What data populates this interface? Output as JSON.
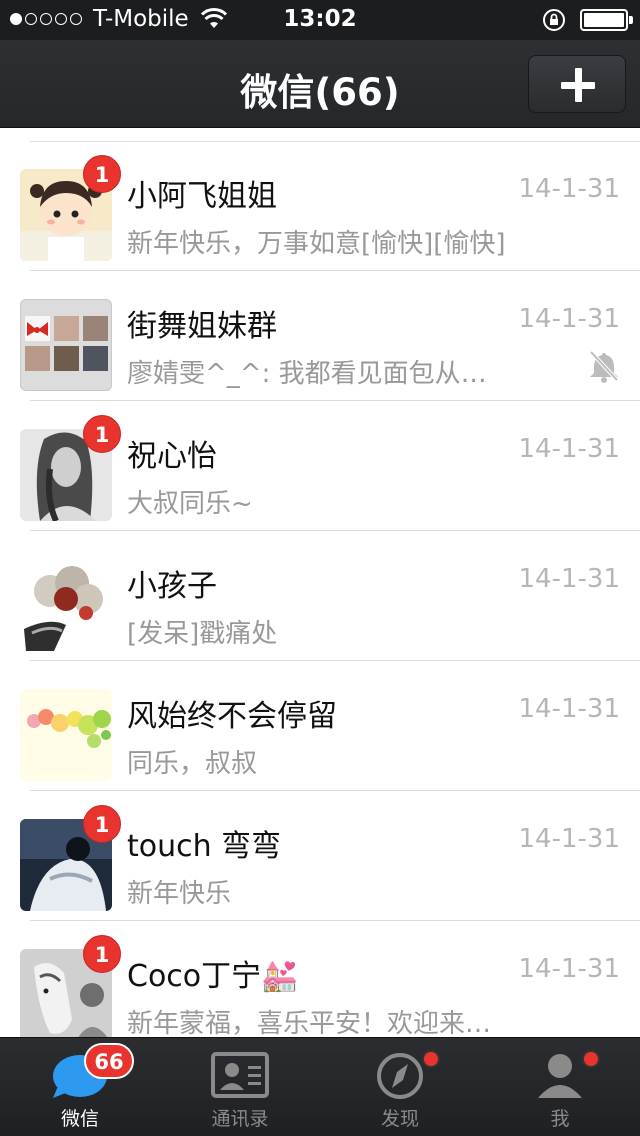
{
  "status_bar": {
    "carrier": "T-Mobile",
    "time": "13:02",
    "signal_bars_filled": 1,
    "signal_bars_total": 5,
    "battery_level": 1.0
  },
  "nav": {
    "title": "微信(66)",
    "add_icon": "plus-icon"
  },
  "chats": [
    {
      "name": "小阿飞姐姐",
      "time": "14-1-31",
      "preview": "新年快乐，万事如意[愉快][愉快]",
      "unread": "1",
      "muted": false
    },
    {
      "name": "街舞姐妹群",
      "time": "14-1-31",
      "preview": "廖婧雯^_^: 我都看见面包从…",
      "unread": "",
      "muted": true
    },
    {
      "name": "祝心怡",
      "time": "14-1-31",
      "preview": "大叔同乐~",
      "unread": "1",
      "muted": false
    },
    {
      "name": "小孩子",
      "time": "14-1-31",
      "preview": "[发呆]戳痛处",
      "unread": "",
      "muted": false
    },
    {
      "name": "风始终不会停留",
      "time": "14-1-31",
      "preview": "同乐，叔叔",
      "unread": "",
      "muted": false
    },
    {
      "name": "touch 弯弯",
      "time": "14-1-31",
      "preview": "新年快乐",
      "unread": "1",
      "muted": false
    },
    {
      "name": "Coco丁宁💒",
      "time": "14-1-31",
      "preview": "新年蒙福，喜乐平安！欢迎来…",
      "unread": "1",
      "muted": false
    }
  ],
  "tabs": [
    {
      "label": "微信",
      "icon": "chat-bubble-icon",
      "badge": "66",
      "dot": false,
      "active": true
    },
    {
      "label": "通讯录",
      "icon": "contacts-card-icon",
      "badge": "",
      "dot": false,
      "active": false
    },
    {
      "label": "发现",
      "icon": "compass-icon",
      "badge": "",
      "dot": true,
      "active": false
    },
    {
      "label": "我",
      "icon": "person-icon",
      "badge": "",
      "dot": true,
      "active": false
    }
  ],
  "colors": {
    "accent": "#e8332e",
    "nav_bg": "#2b2e31",
    "time_text": "#b6b6b6",
    "preview_text": "#999999",
    "chat_blue": "#2d9af0"
  }
}
